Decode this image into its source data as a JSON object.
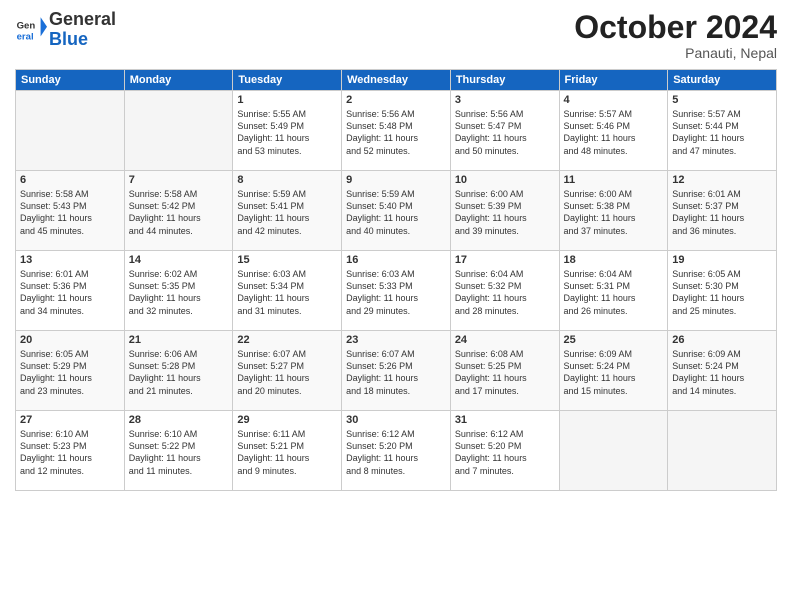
{
  "logo": {
    "general": "General",
    "blue": "Blue"
  },
  "title": "October 2024",
  "location": "Panauti, Nepal",
  "days_of_week": [
    "Sunday",
    "Monday",
    "Tuesday",
    "Wednesday",
    "Thursday",
    "Friday",
    "Saturday"
  ],
  "weeks": [
    [
      {
        "day": "",
        "info": ""
      },
      {
        "day": "",
        "info": ""
      },
      {
        "day": "1",
        "info": "Sunrise: 5:55 AM\nSunset: 5:49 PM\nDaylight: 11 hours\nand 53 minutes."
      },
      {
        "day": "2",
        "info": "Sunrise: 5:56 AM\nSunset: 5:48 PM\nDaylight: 11 hours\nand 52 minutes."
      },
      {
        "day": "3",
        "info": "Sunrise: 5:56 AM\nSunset: 5:47 PM\nDaylight: 11 hours\nand 50 minutes."
      },
      {
        "day": "4",
        "info": "Sunrise: 5:57 AM\nSunset: 5:46 PM\nDaylight: 11 hours\nand 48 minutes."
      },
      {
        "day": "5",
        "info": "Sunrise: 5:57 AM\nSunset: 5:44 PM\nDaylight: 11 hours\nand 47 minutes."
      }
    ],
    [
      {
        "day": "6",
        "info": "Sunrise: 5:58 AM\nSunset: 5:43 PM\nDaylight: 11 hours\nand 45 minutes."
      },
      {
        "day": "7",
        "info": "Sunrise: 5:58 AM\nSunset: 5:42 PM\nDaylight: 11 hours\nand 44 minutes."
      },
      {
        "day": "8",
        "info": "Sunrise: 5:59 AM\nSunset: 5:41 PM\nDaylight: 11 hours\nand 42 minutes."
      },
      {
        "day": "9",
        "info": "Sunrise: 5:59 AM\nSunset: 5:40 PM\nDaylight: 11 hours\nand 40 minutes."
      },
      {
        "day": "10",
        "info": "Sunrise: 6:00 AM\nSunset: 5:39 PM\nDaylight: 11 hours\nand 39 minutes."
      },
      {
        "day": "11",
        "info": "Sunrise: 6:00 AM\nSunset: 5:38 PM\nDaylight: 11 hours\nand 37 minutes."
      },
      {
        "day": "12",
        "info": "Sunrise: 6:01 AM\nSunset: 5:37 PM\nDaylight: 11 hours\nand 36 minutes."
      }
    ],
    [
      {
        "day": "13",
        "info": "Sunrise: 6:01 AM\nSunset: 5:36 PM\nDaylight: 11 hours\nand 34 minutes."
      },
      {
        "day": "14",
        "info": "Sunrise: 6:02 AM\nSunset: 5:35 PM\nDaylight: 11 hours\nand 32 minutes."
      },
      {
        "day": "15",
        "info": "Sunrise: 6:03 AM\nSunset: 5:34 PM\nDaylight: 11 hours\nand 31 minutes."
      },
      {
        "day": "16",
        "info": "Sunrise: 6:03 AM\nSunset: 5:33 PM\nDaylight: 11 hours\nand 29 minutes."
      },
      {
        "day": "17",
        "info": "Sunrise: 6:04 AM\nSunset: 5:32 PM\nDaylight: 11 hours\nand 28 minutes."
      },
      {
        "day": "18",
        "info": "Sunrise: 6:04 AM\nSunset: 5:31 PM\nDaylight: 11 hours\nand 26 minutes."
      },
      {
        "day": "19",
        "info": "Sunrise: 6:05 AM\nSunset: 5:30 PM\nDaylight: 11 hours\nand 25 minutes."
      }
    ],
    [
      {
        "day": "20",
        "info": "Sunrise: 6:05 AM\nSunset: 5:29 PM\nDaylight: 11 hours\nand 23 minutes."
      },
      {
        "day": "21",
        "info": "Sunrise: 6:06 AM\nSunset: 5:28 PM\nDaylight: 11 hours\nand 21 minutes."
      },
      {
        "day": "22",
        "info": "Sunrise: 6:07 AM\nSunset: 5:27 PM\nDaylight: 11 hours\nand 20 minutes."
      },
      {
        "day": "23",
        "info": "Sunrise: 6:07 AM\nSunset: 5:26 PM\nDaylight: 11 hours\nand 18 minutes."
      },
      {
        "day": "24",
        "info": "Sunrise: 6:08 AM\nSunset: 5:25 PM\nDaylight: 11 hours\nand 17 minutes."
      },
      {
        "day": "25",
        "info": "Sunrise: 6:09 AM\nSunset: 5:24 PM\nDaylight: 11 hours\nand 15 minutes."
      },
      {
        "day": "26",
        "info": "Sunrise: 6:09 AM\nSunset: 5:24 PM\nDaylight: 11 hours\nand 14 minutes."
      }
    ],
    [
      {
        "day": "27",
        "info": "Sunrise: 6:10 AM\nSunset: 5:23 PM\nDaylight: 11 hours\nand 12 minutes."
      },
      {
        "day": "28",
        "info": "Sunrise: 6:10 AM\nSunset: 5:22 PM\nDaylight: 11 hours\nand 11 minutes."
      },
      {
        "day": "29",
        "info": "Sunrise: 6:11 AM\nSunset: 5:21 PM\nDaylight: 11 hours\nand 9 minutes."
      },
      {
        "day": "30",
        "info": "Sunrise: 6:12 AM\nSunset: 5:20 PM\nDaylight: 11 hours\nand 8 minutes."
      },
      {
        "day": "31",
        "info": "Sunrise: 6:12 AM\nSunset: 5:20 PM\nDaylight: 11 hours\nand 7 minutes."
      },
      {
        "day": "",
        "info": ""
      },
      {
        "day": "",
        "info": ""
      }
    ]
  ]
}
